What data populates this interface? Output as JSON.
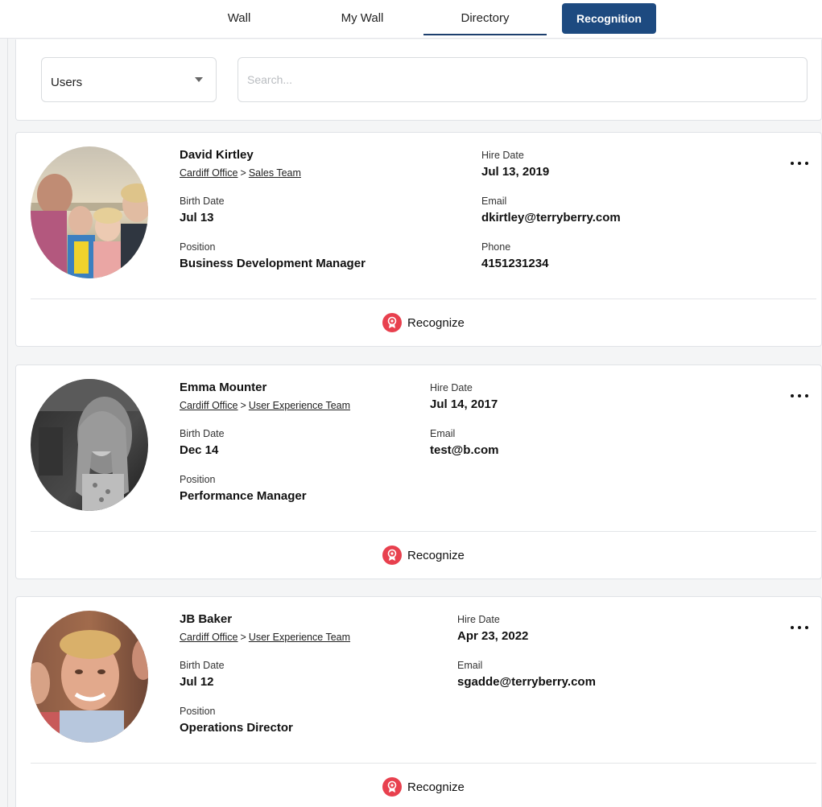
{
  "nav": {
    "tabs": [
      {
        "label": "Wall"
      },
      {
        "label": "My Wall"
      },
      {
        "label": "Directory"
      },
      {
        "label": "Recognition"
      }
    ]
  },
  "filters": {
    "type_select_value": "Users",
    "search_placeholder": "Search..."
  },
  "labels": {
    "hire_date": "Hire Date",
    "birth_date": "Birth Date",
    "position": "Position",
    "email": "Email",
    "phone": "Phone",
    "recognize": "Recognize",
    "breadcrumb_sep": ">"
  },
  "users": [
    {
      "name": "David Kirtley",
      "office": "Cardiff Office",
      "team": "Sales Team",
      "hire_date": "Jul 13, 2019",
      "birth_date": "Jul 13",
      "email": "dkirtley@terryberry.com",
      "position": "Business Development Manager",
      "phone": "4151231234"
    },
    {
      "name": "Emma Mounter",
      "office": "Cardiff Office",
      "team": "User Experience Team",
      "hire_date": "Jul 14, 2017",
      "birth_date": "Dec 14",
      "email": "test@b.com",
      "position": "Performance Manager"
    },
    {
      "name": "JB Baker",
      "office": "Cardiff Office",
      "team": "User Experience Team",
      "hire_date": "Apr 23, 2022",
      "birth_date": "Jul 12",
      "email": "sgadde@terryberry.com",
      "position": "Operations Director"
    }
  ],
  "colors": {
    "primary": "#1d4a80",
    "recognize_icon": "#e8404e"
  }
}
